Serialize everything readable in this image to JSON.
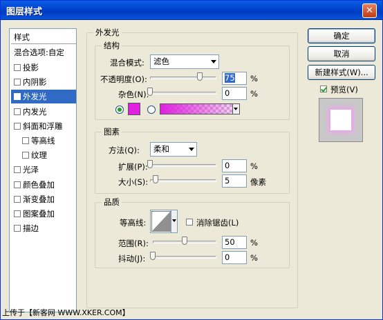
{
  "window": {
    "title": "图层样式",
    "close_glyph": "✕"
  },
  "styles": {
    "header": "样式",
    "items": [
      {
        "label": "混合选项:自定",
        "checkbox": false,
        "checked": false,
        "indent": 0
      },
      {
        "label": "投影",
        "checkbox": true,
        "checked": false,
        "indent": 0
      },
      {
        "label": "内阴影",
        "checkbox": true,
        "checked": false,
        "indent": 0
      },
      {
        "label": "外发光",
        "checkbox": true,
        "checked": true,
        "indent": 0,
        "selected": true
      },
      {
        "label": "内发光",
        "checkbox": true,
        "checked": false,
        "indent": 0
      },
      {
        "label": "斜面和浮雕",
        "checkbox": true,
        "checked": false,
        "indent": 0
      },
      {
        "label": "等高线",
        "checkbox": true,
        "checked": false,
        "indent": 1
      },
      {
        "label": "纹理",
        "checkbox": true,
        "checked": false,
        "indent": 1
      },
      {
        "label": "光泽",
        "checkbox": true,
        "checked": false,
        "indent": 0
      },
      {
        "label": "颜色叠加",
        "checkbox": true,
        "checked": false,
        "indent": 0
      },
      {
        "label": "渐变叠加",
        "checkbox": true,
        "checked": false,
        "indent": 0
      },
      {
        "label": "图案叠加",
        "checkbox": true,
        "checked": false,
        "indent": 0
      },
      {
        "label": "描边",
        "checkbox": true,
        "checked": false,
        "indent": 0
      }
    ]
  },
  "outer_glow": {
    "title": "外发光",
    "structure": {
      "title": "结构",
      "blend_mode_label": "混合模式:",
      "blend_mode_value": "滤色",
      "opacity_label": "不透明度(O):",
      "opacity_value": "75",
      "opacity_unit": "%",
      "opacity_level": 0.75,
      "noise_label": "杂色(N):",
      "noise_value": "0",
      "noise_unit": "%",
      "glow_color": "#e020e0"
    },
    "elements": {
      "title": "图素",
      "method_label": "方法(Q):",
      "method_value": "柔和",
      "spread_label": "扩展(P):",
      "spread_value": "0",
      "spread_unit": "%",
      "size_label": "大小(S):",
      "size_value": "5",
      "size_unit": "像素"
    },
    "quality": {
      "title": "品质",
      "contour_label": "等高线:",
      "antialias_label": "消除锯齿(L)",
      "antialias_checked": false,
      "range_label": "范围(R):",
      "range_value": "50",
      "range_unit": "%",
      "jitter_label": "抖动(J):",
      "jitter_value": "0",
      "jitter_unit": "%"
    }
  },
  "buttons": {
    "ok": "确定",
    "cancel": "取消",
    "new_style": "新建样式(W)...",
    "preview_label": "预览(V)",
    "preview_checked": true
  },
  "watermark": "上传于【新客网 WWW.XKER.COM】"
}
